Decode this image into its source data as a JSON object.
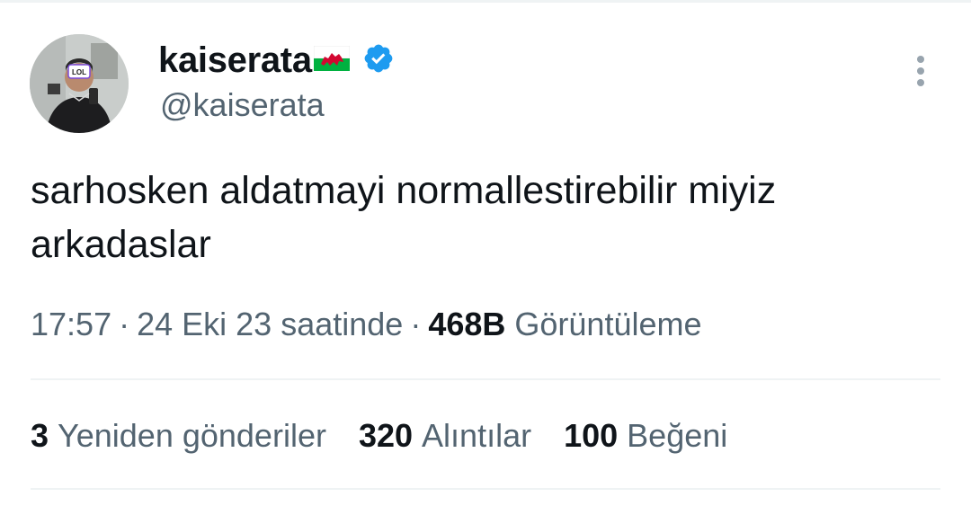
{
  "author": {
    "display_name": "kaiserata",
    "handle": "@kaiserata",
    "flag": "wales-flag-icon",
    "verified": true,
    "verified_color": "#1d9bf0"
  },
  "tweet": {
    "text": "sarhosken aldatmayi normallestirebilir miyiz\narkadaslar",
    "time": "17:57",
    "date": "24 Eki 23 saatinde",
    "views_count": "468B",
    "views_label": "Görüntüleme"
  },
  "stats": [
    {
      "count": "3",
      "label": "Yeniden gönderiler"
    },
    {
      "count": "320",
      "label": "Alıntılar"
    },
    {
      "count": "100",
      "label": "Beğeni"
    }
  ],
  "colors": {
    "text": "#0f1419",
    "secondary": "#536471",
    "divider": "#eff3f4"
  }
}
